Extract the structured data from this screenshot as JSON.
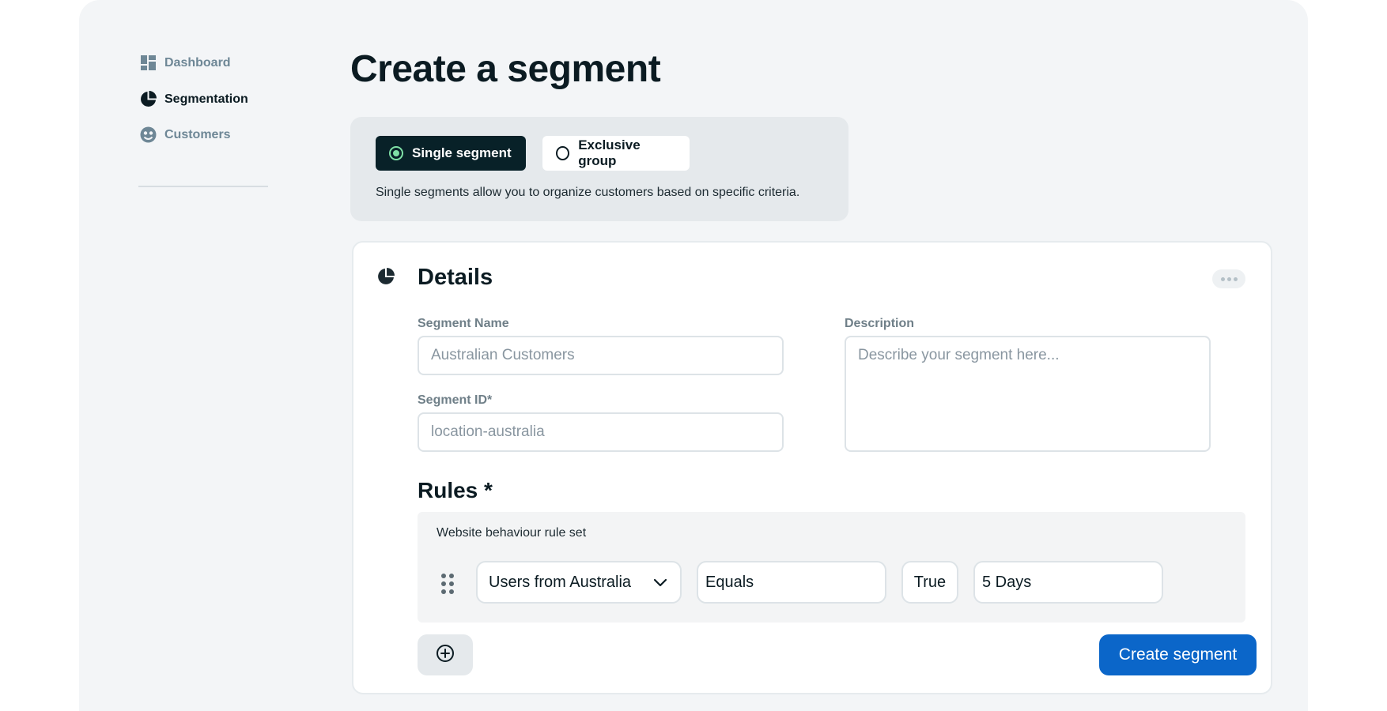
{
  "sidebar": {
    "items": [
      {
        "label": "Dashboard",
        "icon": "dashboard-icon",
        "active": false
      },
      {
        "label": "Segmentation",
        "icon": "pie-chart-icon",
        "active": true
      },
      {
        "label": "Customers",
        "icon": "customer-face-icon",
        "active": false
      }
    ]
  },
  "page": {
    "title": "Create a segment"
  },
  "segment_type": {
    "options": [
      {
        "label": "Single segment",
        "selected": true
      },
      {
        "label": "Exclusive group",
        "selected": false
      }
    ],
    "description": "Single segments allow you to organize customers based on specific criteria."
  },
  "details": {
    "title": "Details",
    "segment_name": {
      "label": "Segment Name",
      "placeholder": "Australian Customers",
      "value": ""
    },
    "segment_id": {
      "label": "Segment ID*",
      "placeholder": "location-australia",
      "value": ""
    },
    "description": {
      "label": "Description",
      "placeholder": "Describe your segment here...",
      "value": ""
    }
  },
  "rules": {
    "title": "Rules *",
    "rule_set": {
      "title": "Website behaviour rule set",
      "rule": {
        "attribute": "Users from Australia",
        "operator": "Equals",
        "value": "True",
        "period": "5 Days"
      }
    }
  },
  "actions": {
    "create_label": "Create segment"
  },
  "colors": {
    "accent": "#0b66c9",
    "selected_segment_bg": "#082128",
    "radio_on": "#7fe0a6",
    "app_bg": "#f3f5f7"
  }
}
